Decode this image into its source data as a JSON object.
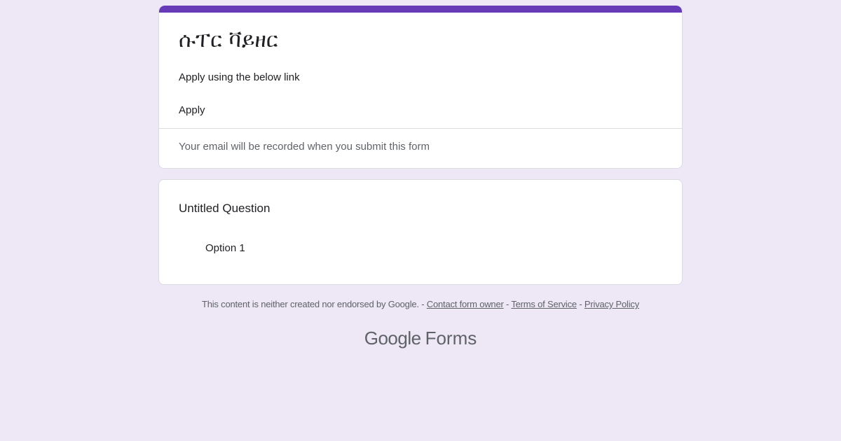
{
  "form": {
    "accent_color": "#673ab7",
    "title": "ሱፐር ቫይዘር",
    "description_lines": [
      "Apply using the below link",
      "Apply"
    ],
    "email_note": "Your email will be recorded when you submit this form"
  },
  "question": {
    "title": "Untitled Question",
    "options": [
      {
        "label": "Option 1"
      }
    ]
  },
  "footer": {
    "disclaimer": "This content is neither created nor endorsed by Google.",
    "separator": " - ",
    "links": [
      {
        "label": "Contact form owner"
      },
      {
        "label": "Terms of Service"
      },
      {
        "label": "Privacy Policy"
      }
    ]
  },
  "brand": {
    "google": "Google",
    "product": "Forms"
  }
}
